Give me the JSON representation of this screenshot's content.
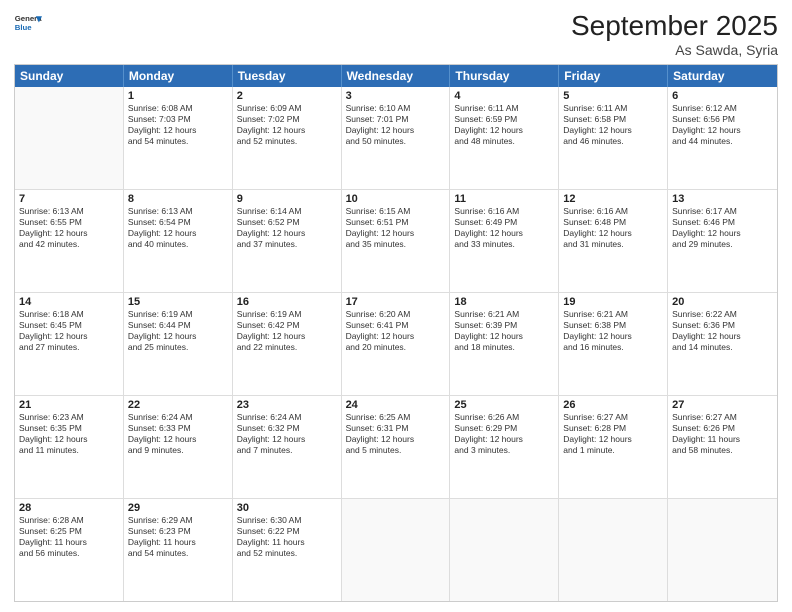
{
  "header": {
    "logo_general": "General",
    "logo_blue": "Blue",
    "title": "September 2025",
    "subtitle": "As Sawda, Syria"
  },
  "days_of_week": [
    "Sunday",
    "Monday",
    "Tuesday",
    "Wednesday",
    "Thursday",
    "Friday",
    "Saturday"
  ],
  "weeks": [
    [
      {
        "day": "",
        "lines": []
      },
      {
        "day": "1",
        "lines": [
          "Sunrise: 6:08 AM",
          "Sunset: 7:03 PM",
          "Daylight: 12 hours",
          "and 54 minutes."
        ]
      },
      {
        "day": "2",
        "lines": [
          "Sunrise: 6:09 AM",
          "Sunset: 7:02 PM",
          "Daylight: 12 hours",
          "and 52 minutes."
        ]
      },
      {
        "day": "3",
        "lines": [
          "Sunrise: 6:10 AM",
          "Sunset: 7:01 PM",
          "Daylight: 12 hours",
          "and 50 minutes."
        ]
      },
      {
        "day": "4",
        "lines": [
          "Sunrise: 6:11 AM",
          "Sunset: 6:59 PM",
          "Daylight: 12 hours",
          "and 48 minutes."
        ]
      },
      {
        "day": "5",
        "lines": [
          "Sunrise: 6:11 AM",
          "Sunset: 6:58 PM",
          "Daylight: 12 hours",
          "and 46 minutes."
        ]
      },
      {
        "day": "6",
        "lines": [
          "Sunrise: 6:12 AM",
          "Sunset: 6:56 PM",
          "Daylight: 12 hours",
          "and 44 minutes."
        ]
      }
    ],
    [
      {
        "day": "7",
        "lines": [
          "Sunrise: 6:13 AM",
          "Sunset: 6:55 PM",
          "Daylight: 12 hours",
          "and 42 minutes."
        ]
      },
      {
        "day": "8",
        "lines": [
          "Sunrise: 6:13 AM",
          "Sunset: 6:54 PM",
          "Daylight: 12 hours",
          "and 40 minutes."
        ]
      },
      {
        "day": "9",
        "lines": [
          "Sunrise: 6:14 AM",
          "Sunset: 6:52 PM",
          "Daylight: 12 hours",
          "and 37 minutes."
        ]
      },
      {
        "day": "10",
        "lines": [
          "Sunrise: 6:15 AM",
          "Sunset: 6:51 PM",
          "Daylight: 12 hours",
          "and 35 minutes."
        ]
      },
      {
        "day": "11",
        "lines": [
          "Sunrise: 6:16 AM",
          "Sunset: 6:49 PM",
          "Daylight: 12 hours",
          "and 33 minutes."
        ]
      },
      {
        "day": "12",
        "lines": [
          "Sunrise: 6:16 AM",
          "Sunset: 6:48 PM",
          "Daylight: 12 hours",
          "and 31 minutes."
        ]
      },
      {
        "day": "13",
        "lines": [
          "Sunrise: 6:17 AM",
          "Sunset: 6:46 PM",
          "Daylight: 12 hours",
          "and 29 minutes."
        ]
      }
    ],
    [
      {
        "day": "14",
        "lines": [
          "Sunrise: 6:18 AM",
          "Sunset: 6:45 PM",
          "Daylight: 12 hours",
          "and 27 minutes."
        ]
      },
      {
        "day": "15",
        "lines": [
          "Sunrise: 6:19 AM",
          "Sunset: 6:44 PM",
          "Daylight: 12 hours",
          "and 25 minutes."
        ]
      },
      {
        "day": "16",
        "lines": [
          "Sunrise: 6:19 AM",
          "Sunset: 6:42 PM",
          "Daylight: 12 hours",
          "and 22 minutes."
        ]
      },
      {
        "day": "17",
        "lines": [
          "Sunrise: 6:20 AM",
          "Sunset: 6:41 PM",
          "Daylight: 12 hours",
          "and 20 minutes."
        ]
      },
      {
        "day": "18",
        "lines": [
          "Sunrise: 6:21 AM",
          "Sunset: 6:39 PM",
          "Daylight: 12 hours",
          "and 18 minutes."
        ]
      },
      {
        "day": "19",
        "lines": [
          "Sunrise: 6:21 AM",
          "Sunset: 6:38 PM",
          "Daylight: 12 hours",
          "and 16 minutes."
        ]
      },
      {
        "day": "20",
        "lines": [
          "Sunrise: 6:22 AM",
          "Sunset: 6:36 PM",
          "Daylight: 12 hours",
          "and 14 minutes."
        ]
      }
    ],
    [
      {
        "day": "21",
        "lines": [
          "Sunrise: 6:23 AM",
          "Sunset: 6:35 PM",
          "Daylight: 12 hours",
          "and 11 minutes."
        ]
      },
      {
        "day": "22",
        "lines": [
          "Sunrise: 6:24 AM",
          "Sunset: 6:33 PM",
          "Daylight: 12 hours",
          "and 9 minutes."
        ]
      },
      {
        "day": "23",
        "lines": [
          "Sunrise: 6:24 AM",
          "Sunset: 6:32 PM",
          "Daylight: 12 hours",
          "and 7 minutes."
        ]
      },
      {
        "day": "24",
        "lines": [
          "Sunrise: 6:25 AM",
          "Sunset: 6:31 PM",
          "Daylight: 12 hours",
          "and 5 minutes."
        ]
      },
      {
        "day": "25",
        "lines": [
          "Sunrise: 6:26 AM",
          "Sunset: 6:29 PM",
          "Daylight: 12 hours",
          "and 3 minutes."
        ]
      },
      {
        "day": "26",
        "lines": [
          "Sunrise: 6:27 AM",
          "Sunset: 6:28 PM",
          "Daylight: 12 hours",
          "and 1 minute."
        ]
      },
      {
        "day": "27",
        "lines": [
          "Sunrise: 6:27 AM",
          "Sunset: 6:26 PM",
          "Daylight: 11 hours",
          "and 58 minutes."
        ]
      }
    ],
    [
      {
        "day": "28",
        "lines": [
          "Sunrise: 6:28 AM",
          "Sunset: 6:25 PM",
          "Daylight: 11 hours",
          "and 56 minutes."
        ]
      },
      {
        "day": "29",
        "lines": [
          "Sunrise: 6:29 AM",
          "Sunset: 6:23 PM",
          "Daylight: 11 hours",
          "and 54 minutes."
        ]
      },
      {
        "day": "30",
        "lines": [
          "Sunrise: 6:30 AM",
          "Sunset: 6:22 PM",
          "Daylight: 11 hours",
          "and 52 minutes."
        ]
      },
      {
        "day": "",
        "lines": []
      },
      {
        "day": "",
        "lines": []
      },
      {
        "day": "",
        "lines": []
      },
      {
        "day": "",
        "lines": []
      }
    ]
  ]
}
